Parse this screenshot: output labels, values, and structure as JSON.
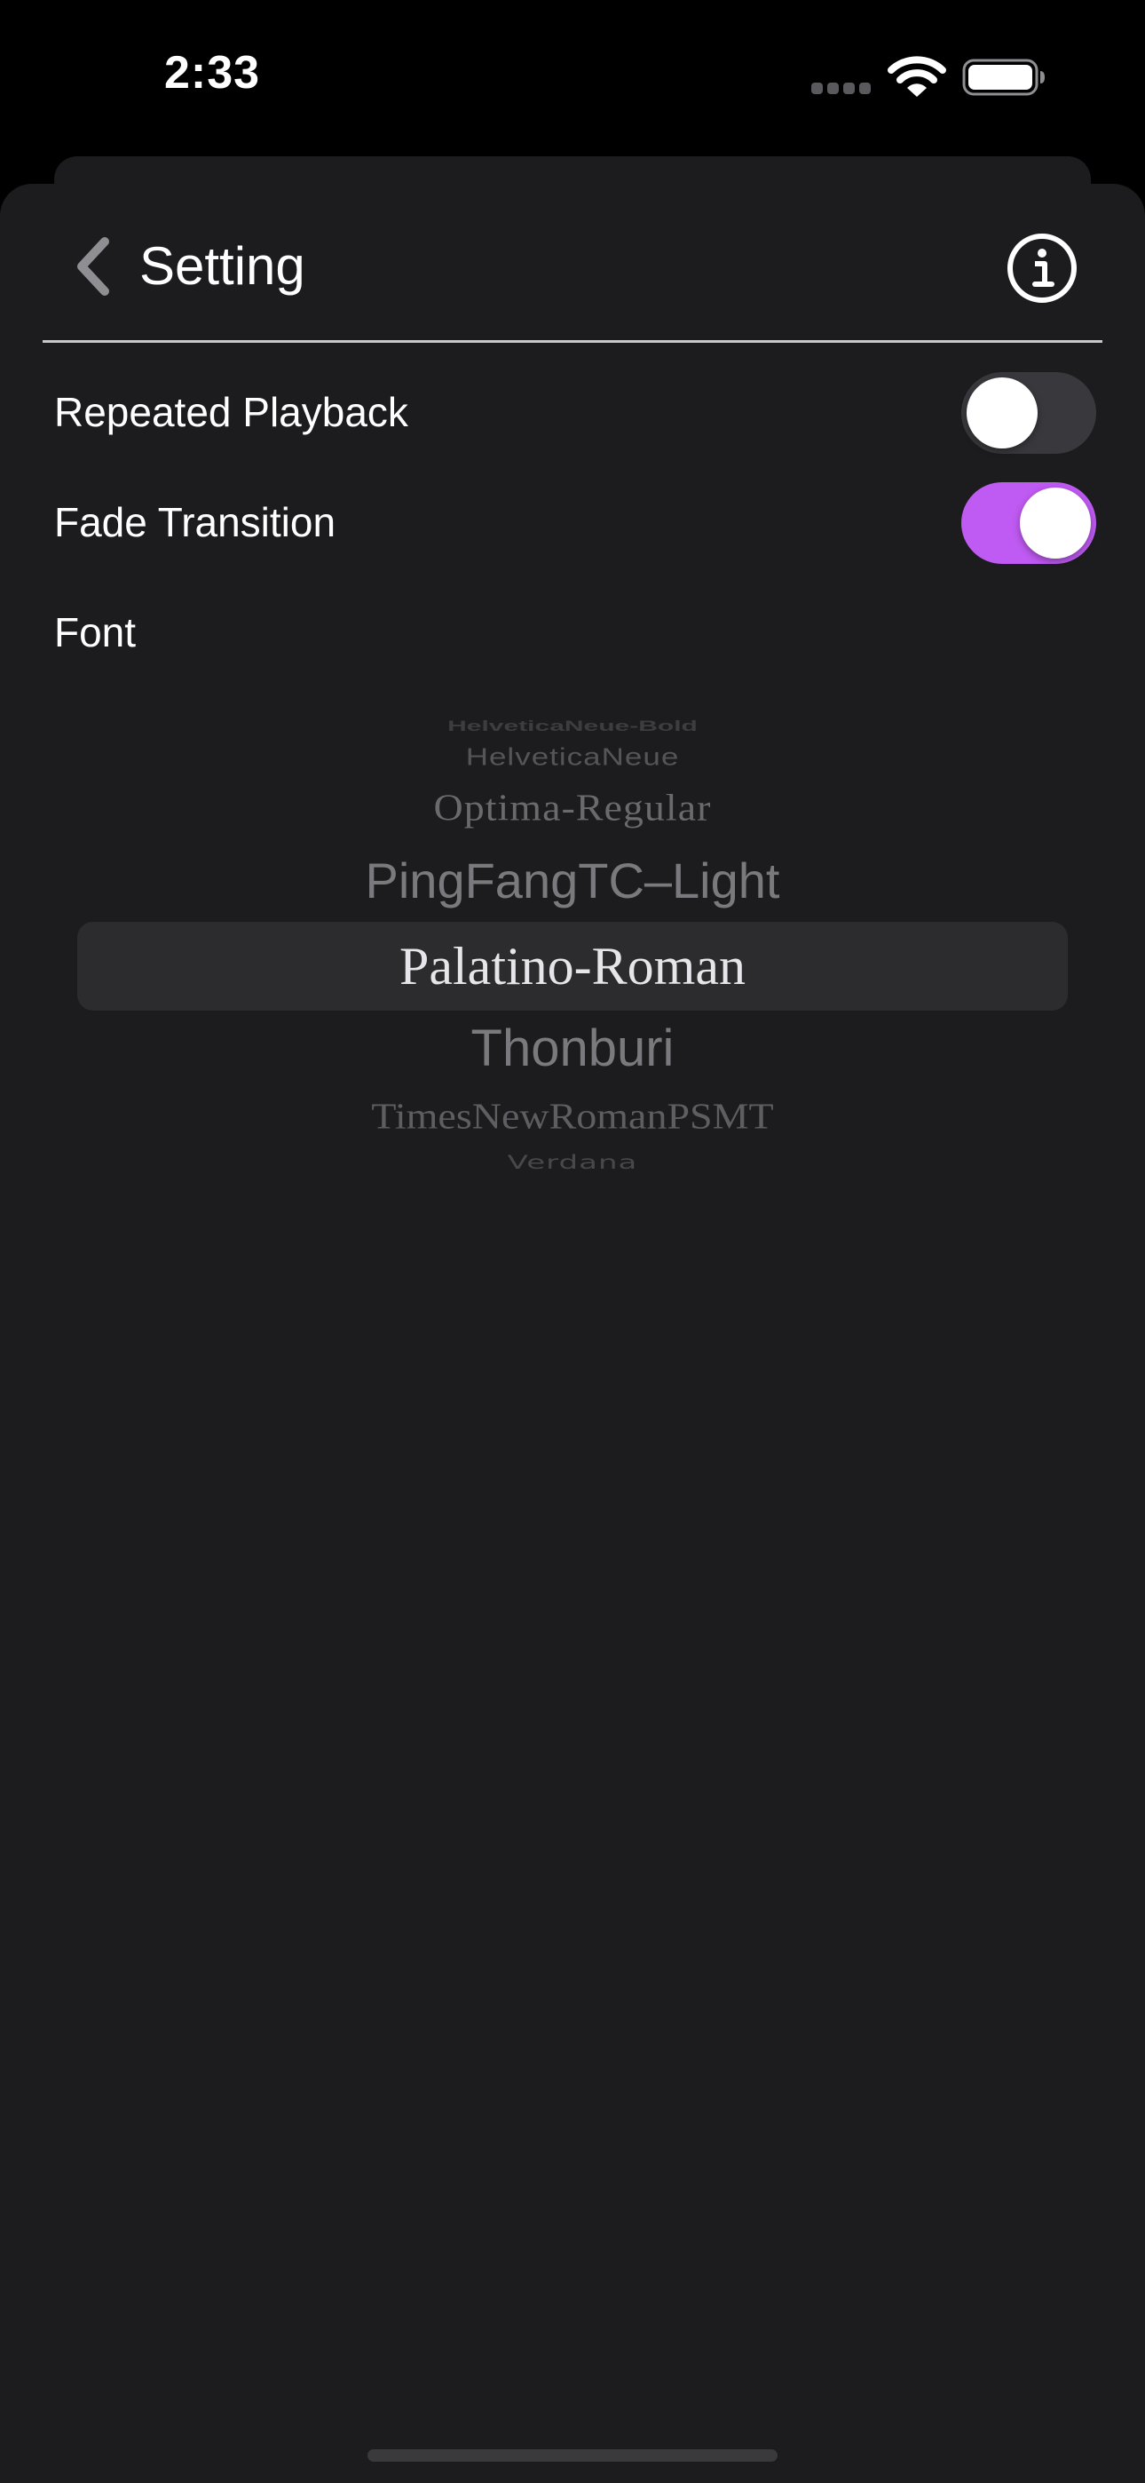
{
  "status_bar": {
    "time": "2:33",
    "signal_icon": "cellular-signal-icon",
    "wifi_icon": "wifi-icon",
    "battery_icon": "battery-icon"
  },
  "nav": {
    "back_icon": "chevron-left-icon",
    "title": "Setting",
    "info_icon": "info-circle-icon"
  },
  "settings": {
    "repeated_playback": {
      "label": "Repeated Playback",
      "enabled": false
    },
    "fade_transition": {
      "label": "Fade Transition",
      "enabled": true
    },
    "font": {
      "label": "Font"
    }
  },
  "font_picker": {
    "options": [
      "HelveticaNeue-Bold",
      "HelveticaNeue",
      "Optima-Regular",
      "PingFangTC–Light",
      "Palatino-Roman",
      "Thonburi",
      "TimesNewRomanPSMT",
      "Verdana"
    ],
    "selected": "Palatino-Roman"
  },
  "colors": {
    "background": "#1c1c1e",
    "accent": "#bf5af2",
    "toggle_off": "#39393d",
    "picker_highlight": "#2c2c2e",
    "secondary_text": "#8e8e93"
  }
}
